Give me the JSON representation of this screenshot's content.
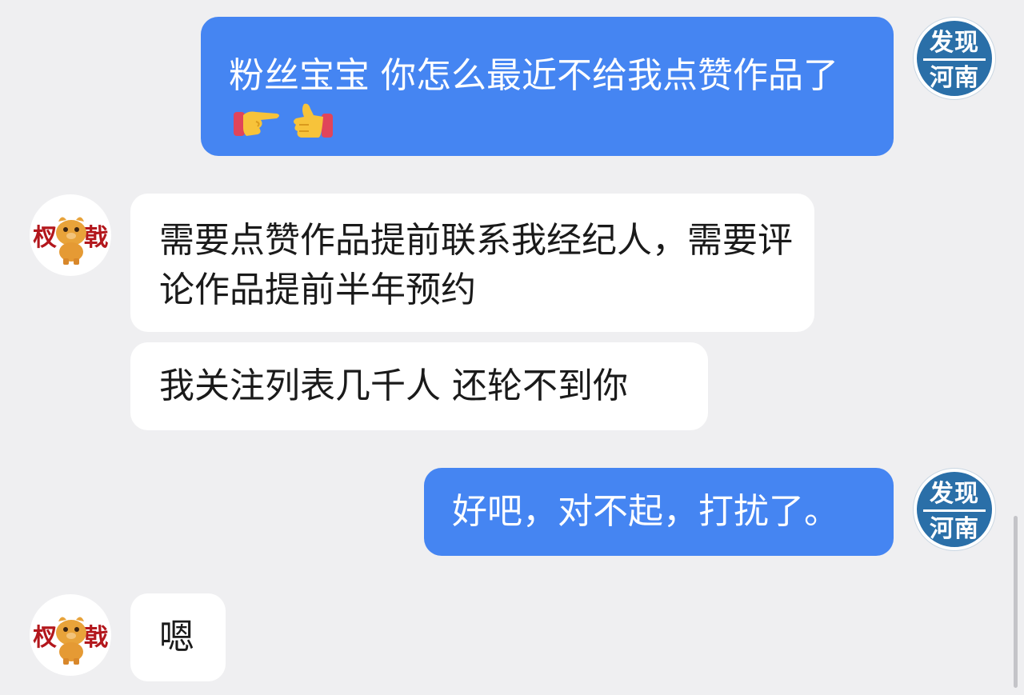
{
  "messages": [
    {
      "side": "out",
      "text": "粉丝宝宝 你怎么最近不给我点赞作品了",
      "emoji": [
        "pointing-right-emoji",
        "thumbs-up-emoji"
      ]
    },
    {
      "side": "in",
      "text": "需要点赞作品提前联系我经纪人，需要评论作品提前半年预约"
    },
    {
      "side": "in",
      "text": "我关注列表几千人 还轮不到你"
    },
    {
      "side": "out",
      "text": "好吧，对不起，打扰了。"
    },
    {
      "side": "in",
      "text": "嗯"
    }
  ],
  "avatars": {
    "self": {
      "line1": "发现",
      "line2": "河南",
      "color": "#2a6fa8"
    },
    "other": {
      "left_char": "杈",
      "right_char": "戟",
      "char_color": "#b3171c",
      "mascot_color": "#e8a33a"
    }
  },
  "colors": {
    "background": "#efeff1",
    "outgoing_bubble": "#4585f2",
    "incoming_bubble": "#ffffff"
  }
}
